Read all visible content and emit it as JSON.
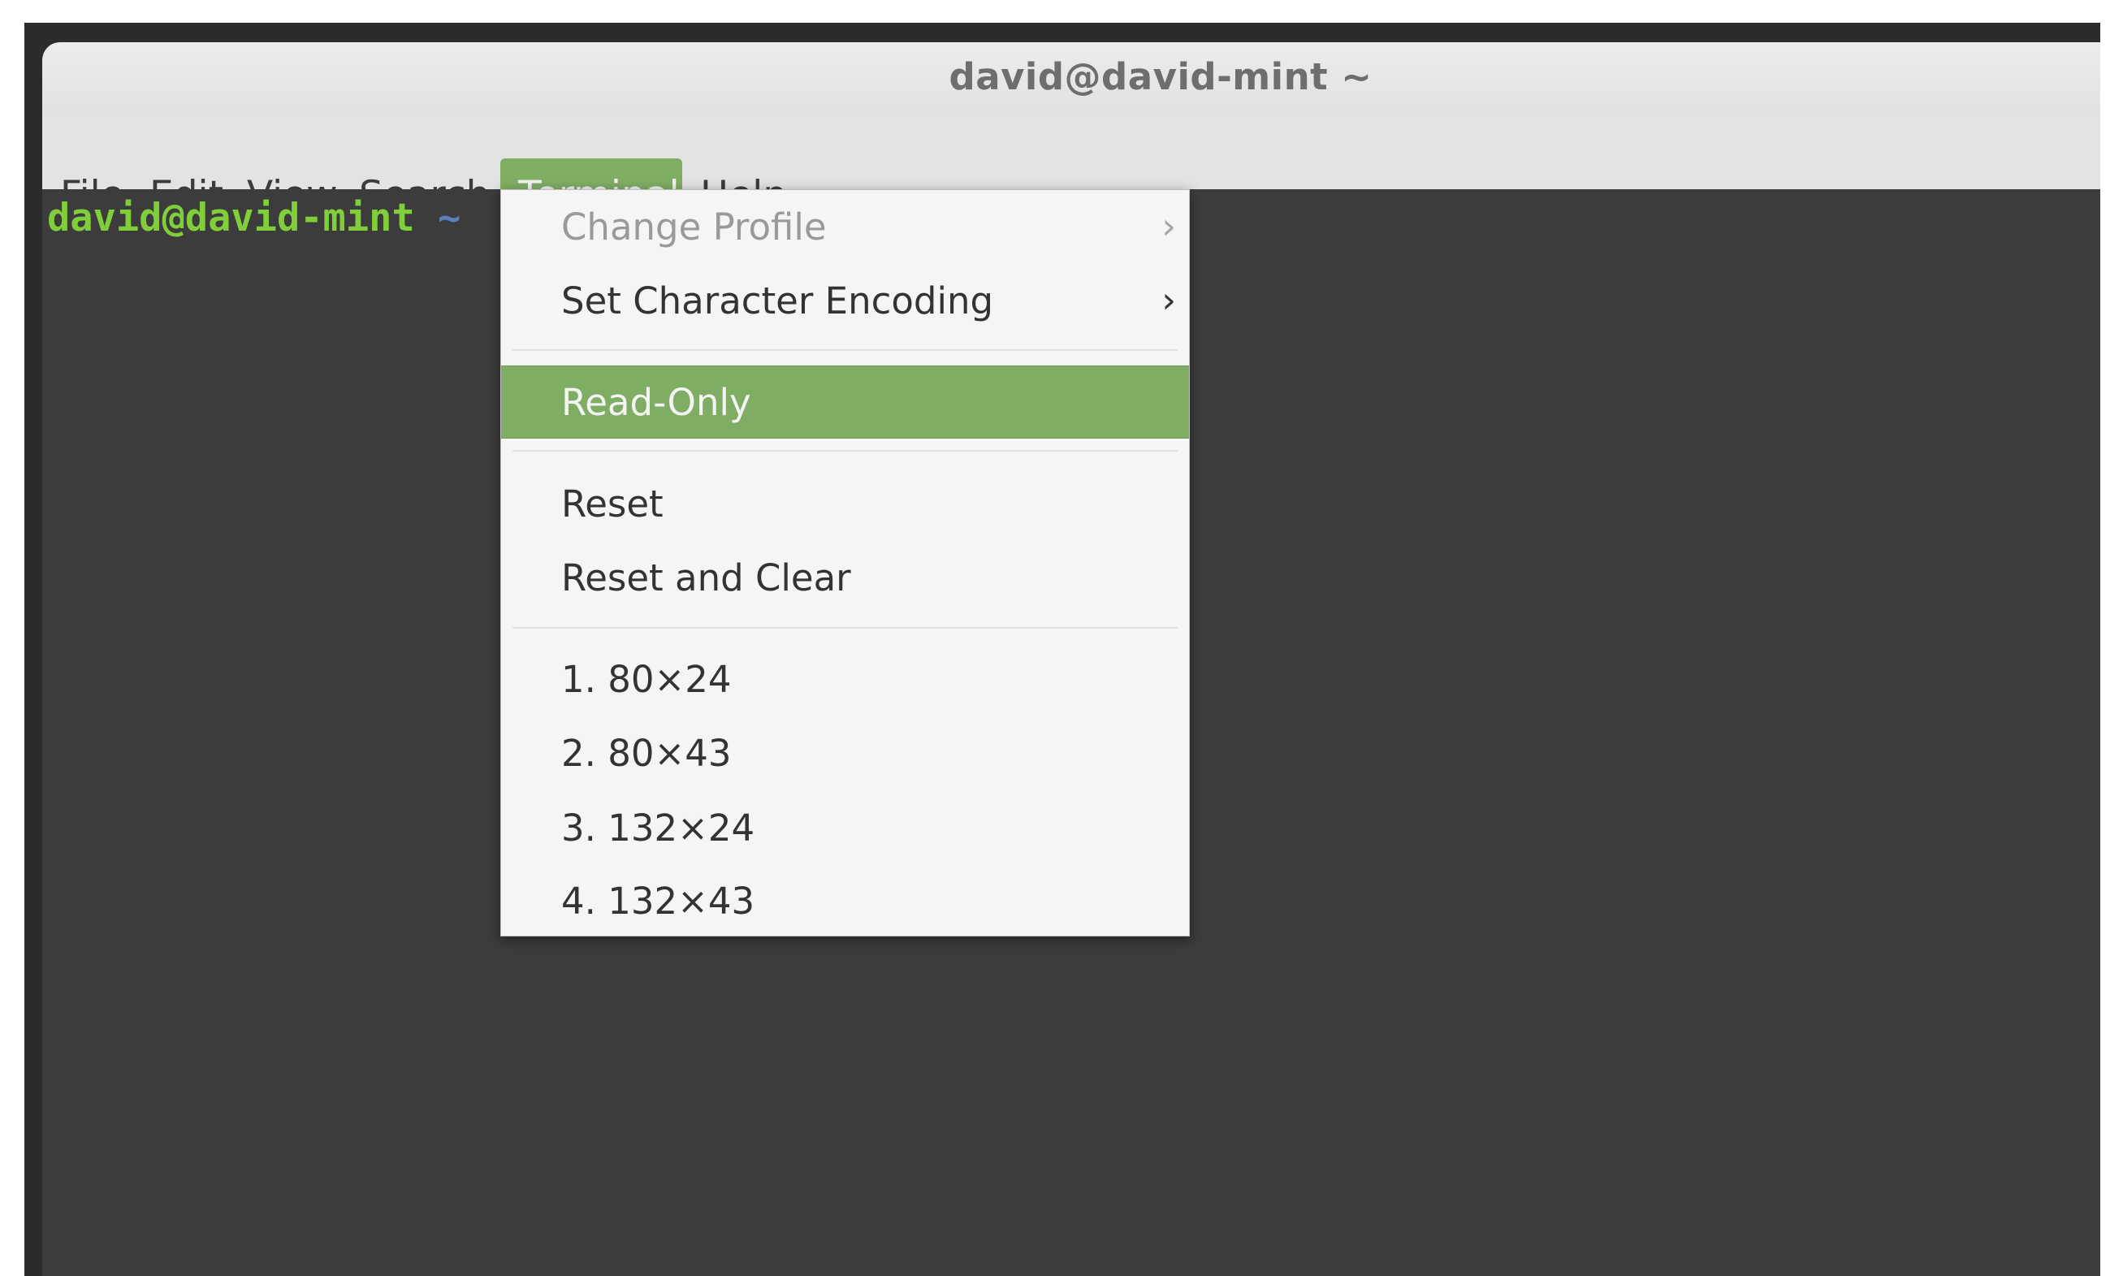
{
  "window": {
    "title": "david@david-mint ~"
  },
  "menubar": {
    "items": [
      {
        "label": "File"
      },
      {
        "label": "Edit"
      },
      {
        "label": "View"
      },
      {
        "label": "Search"
      },
      {
        "label": "Terminal",
        "active": true
      },
      {
        "label": "Help"
      }
    ]
  },
  "terminal": {
    "prompt_user": "david@david-mint",
    "prompt_path": "~"
  },
  "terminal_menu": {
    "items": [
      {
        "label": "Change Profile",
        "submenu": true,
        "enabled": false
      },
      {
        "label": "Set Character Encoding",
        "submenu": true,
        "enabled": true
      },
      {
        "label": "Read-Only",
        "highlighted": true
      },
      {
        "label": "Reset"
      },
      {
        "label": "Reset and Clear"
      },
      {
        "label": "1. 80×24"
      },
      {
        "label": "2. 80×43"
      },
      {
        "label": "3. 132×24"
      },
      {
        "label": "4. 132×43"
      }
    ],
    "submenu_arrow": "›"
  },
  "colors": {
    "accent": "#80ad64",
    "prompt_user": "#7fce3a",
    "prompt_path": "#5c7fb8",
    "terminal_bg": "#3c3c3c"
  }
}
